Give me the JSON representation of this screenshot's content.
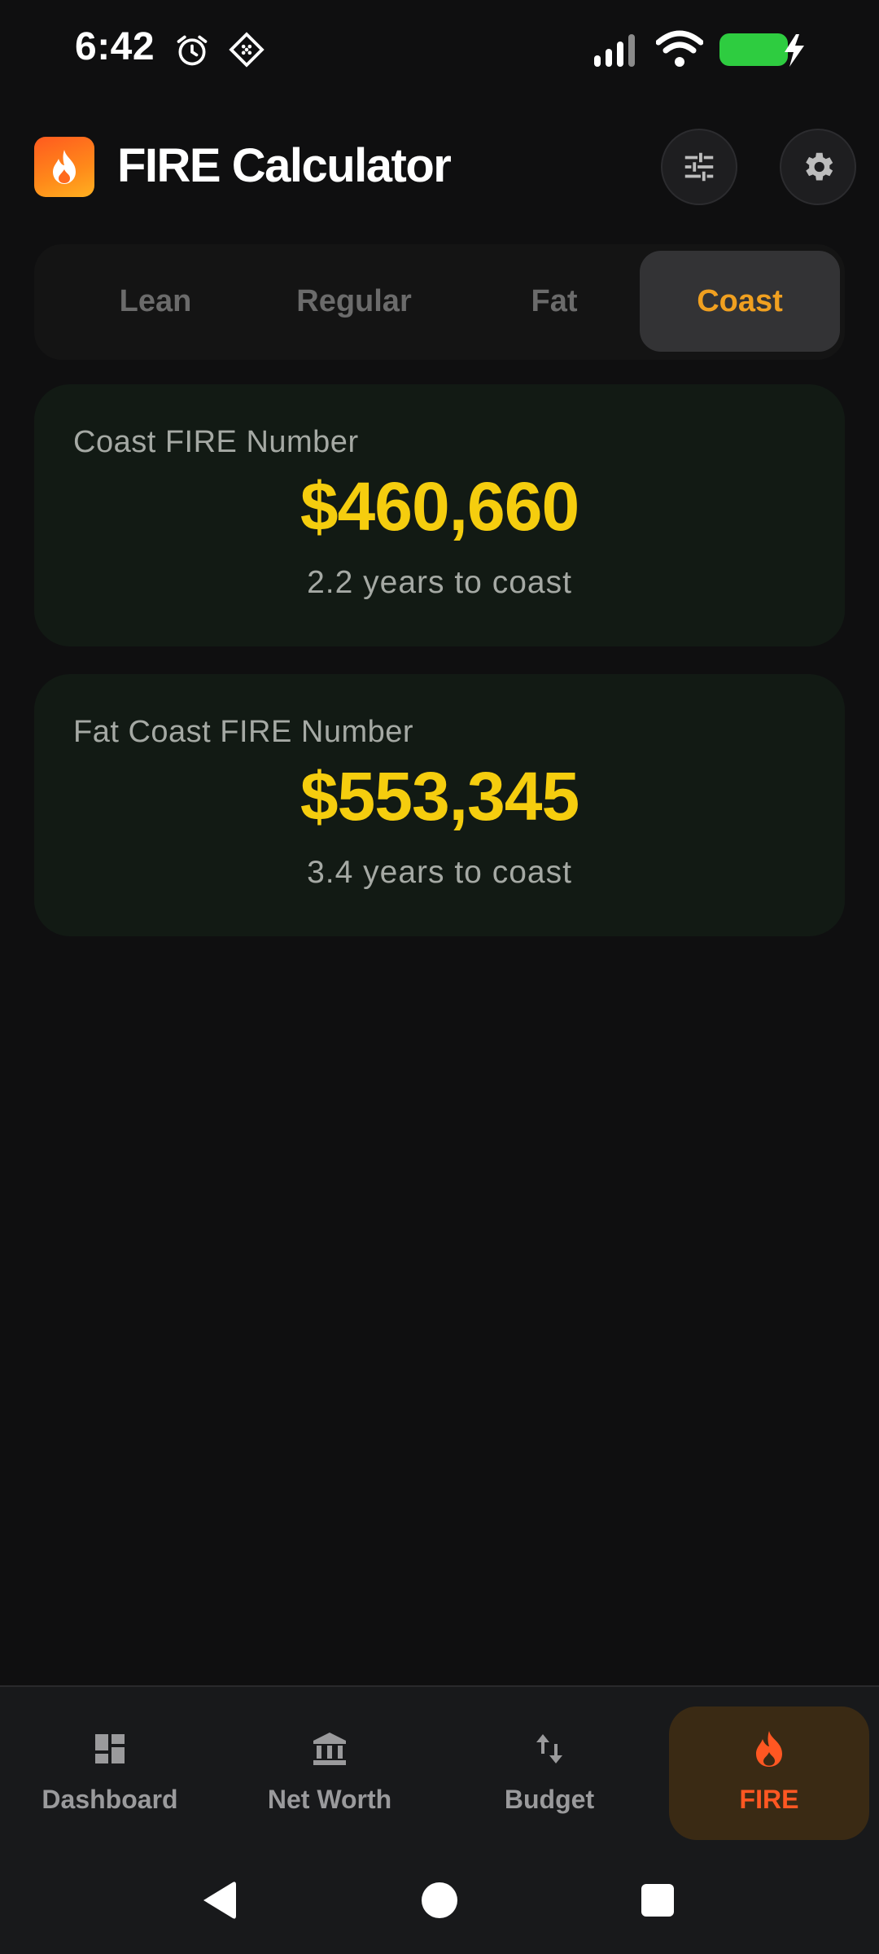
{
  "status_bar": {
    "time": "6:42",
    "icons": [
      "alarm-icon",
      "data-saver-icon",
      "signal-icon",
      "wifi-icon",
      "battery-charging-icon"
    ],
    "battery_color": "#2ecc40"
  },
  "header": {
    "title": "FIRE Calculator",
    "logo_icon": "flame-icon",
    "actions": [
      "tune-icon",
      "gear-icon"
    ]
  },
  "tabs": [
    {
      "label": "Lean",
      "selected": false
    },
    {
      "label": "Regular",
      "selected": false
    },
    {
      "label": "Fat",
      "selected": false
    },
    {
      "label": "Coast",
      "selected": true
    }
  ],
  "cards": [
    {
      "label": "Coast FIRE Number",
      "value": "$460,660",
      "sub": "2.2 years to coast"
    },
    {
      "label": "Fat Coast FIRE Number",
      "value": "$553,345",
      "sub": "3.4 years to coast"
    }
  ],
  "bottom_nav": [
    {
      "label": "Dashboard",
      "icon": "dashboard-icon",
      "selected": false
    },
    {
      "label": "Net Worth",
      "icon": "bank-icon",
      "selected": false
    },
    {
      "label": "Budget",
      "icon": "swap-vert-icon",
      "selected": false
    },
    {
      "label": "FIRE",
      "icon": "flame-icon",
      "selected": true
    }
  ],
  "colors": {
    "accent_value": "#f5cd0e",
    "accent_tab": "#f0a020",
    "accent_fire": "#ff5722",
    "background": "#0f0f10",
    "card_background": "#121a14"
  }
}
